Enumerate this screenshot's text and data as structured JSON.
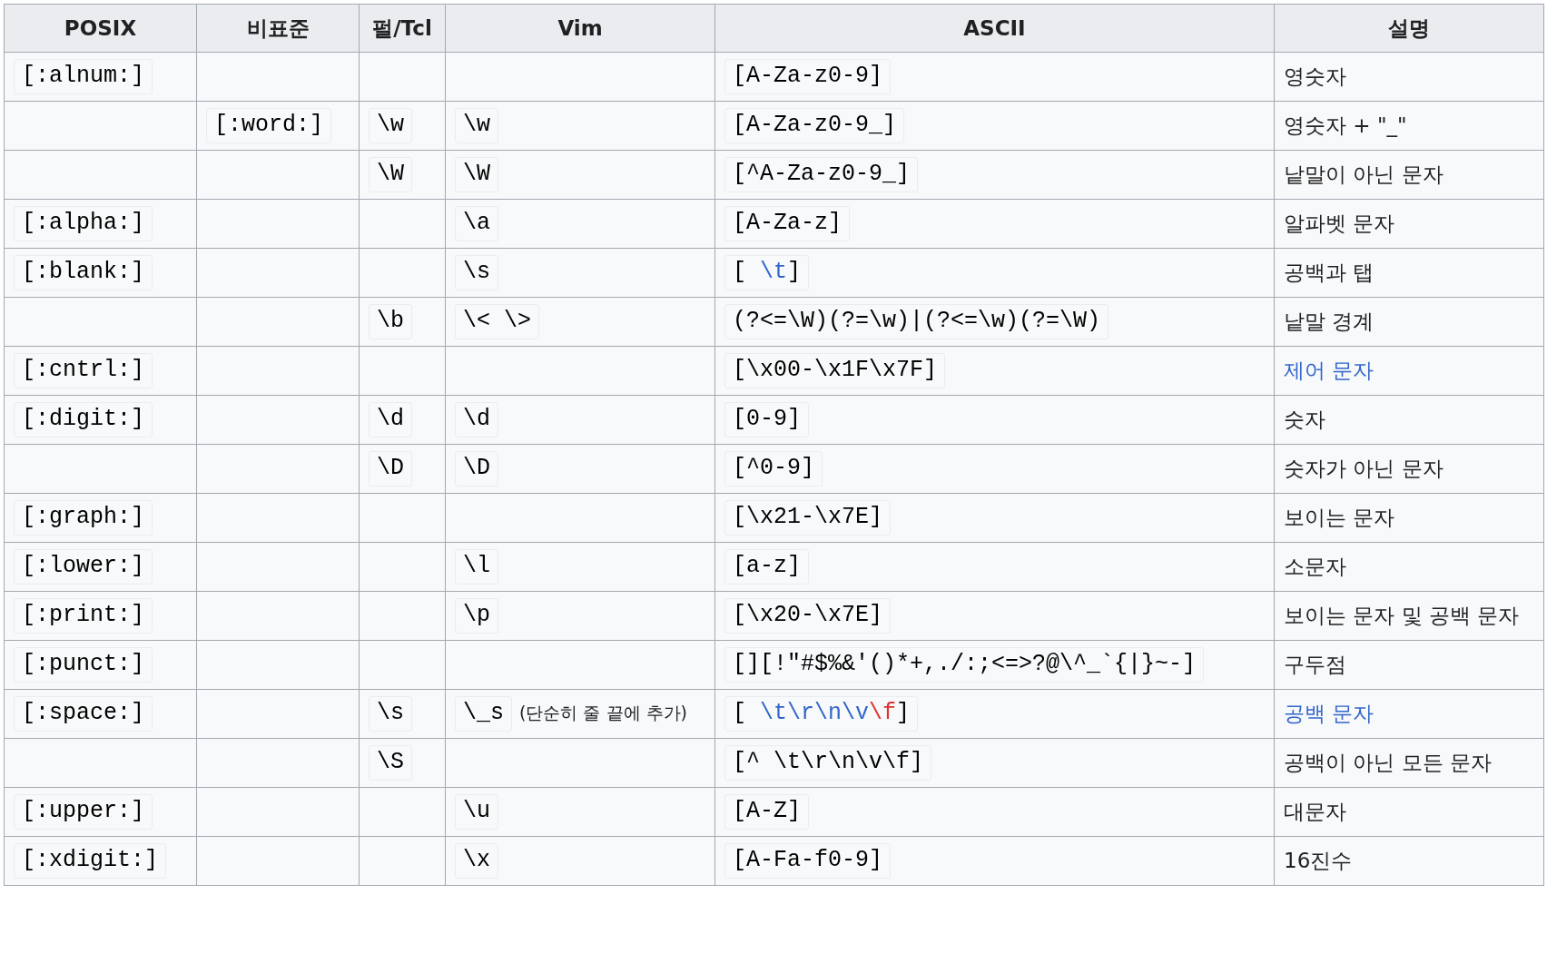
{
  "table": {
    "columns": [
      "POSIX",
      "비표준",
      "펄/Tcl",
      "Vim",
      "ASCII",
      "설명"
    ],
    "rows": [
      {
        "posix": "[:alnum:]",
        "ascii": [
          {
            "text": "[A-Za-z0-9]",
            "kind": "plain"
          }
        ],
        "description": "영숫자",
        "description_link": false
      },
      {
        "nonstandard": "[:word:]",
        "perl_tcl": "\\w",
        "vim": "\\w",
        "ascii": [
          {
            "text": "[A-Za-z0-9_]",
            "kind": "plain"
          }
        ],
        "description": "영숫자 + \"_\"",
        "description_link": false
      },
      {
        "perl_tcl": "\\W",
        "vim": "\\W",
        "ascii": [
          {
            "text": "[^A-Za-z0-9_]",
            "kind": "plain"
          }
        ],
        "description": "낱말이 아닌 문자",
        "description_link": false
      },
      {
        "posix": "[:alpha:]",
        "vim": "\\a",
        "ascii": [
          {
            "text": "[A-Za-z]",
            "kind": "plain"
          }
        ],
        "description": "알파벳 문자",
        "description_link": false
      },
      {
        "posix": "[:blank:]",
        "vim": "\\s",
        "ascii": [
          {
            "text": "[ ",
            "kind": "plain"
          },
          {
            "text": "\\t",
            "kind": "link"
          },
          {
            "text": "]",
            "kind": "plain"
          }
        ],
        "description": "공백과 탭",
        "description_link": false
      },
      {
        "perl_tcl": "\\b",
        "vim": "\\< \\>",
        "ascii": [
          {
            "text": "(?<=\\W)(?=\\w)|(?<=\\w)(?=\\W)",
            "kind": "plain"
          }
        ],
        "description": "낱말 경계",
        "description_link": false
      },
      {
        "posix": "[:cntrl:]",
        "ascii": [
          {
            "text": "[\\x00-\\x1F\\x7F]",
            "kind": "plain"
          }
        ],
        "description": "제어 문자",
        "description_link": true
      },
      {
        "posix": "[:digit:]",
        "perl_tcl": "\\d",
        "vim": "\\d",
        "ascii": [
          {
            "text": "[0-9]",
            "kind": "plain"
          }
        ],
        "description": "숫자",
        "description_link": false
      },
      {
        "perl_tcl": "\\D",
        "vim": "\\D",
        "ascii": [
          {
            "text": "[^0-9]",
            "kind": "plain"
          }
        ],
        "description": "숫자가 아닌 문자",
        "description_link": false
      },
      {
        "posix": "[:graph:]",
        "ascii": [
          {
            "text": "[\\x21-\\x7E]",
            "kind": "plain"
          }
        ],
        "description": "보이는 문자",
        "description_link": false
      },
      {
        "posix": "[:lower:]",
        "vim": "\\l",
        "ascii": [
          {
            "text": "[a-z]",
            "kind": "plain"
          }
        ],
        "description": "소문자",
        "description_link": false
      },
      {
        "posix": "[:print:]",
        "vim": "\\p",
        "ascii": [
          {
            "text": "[\\x20-\\x7E]",
            "kind": "plain"
          }
        ],
        "description": "보이는 문자 및 공백 문자",
        "description_link": false
      },
      {
        "posix": "[:punct:]",
        "ascii": [
          {
            "text": "[][!\"#$%&'()*+,./:;<=>?@\\^_`{|}~-]",
            "kind": "plain"
          }
        ],
        "description": "구두점",
        "description_link": false
      },
      {
        "posix": "[:space:]",
        "perl_tcl": "\\s",
        "vim": "\\_s",
        "vim_note": "(단순히 줄 끝에 추가)",
        "ascii": [
          {
            "text": "[ ",
            "kind": "plain"
          },
          {
            "text": "\\t\\r\\n\\v",
            "kind": "link"
          },
          {
            "text": "\\f",
            "kind": "new-link"
          },
          {
            "text": "]",
            "kind": "plain"
          }
        ],
        "description": "공백 문자",
        "description_link": true
      },
      {
        "perl_tcl": "\\S",
        "ascii": [
          {
            "text": "[^ \\t\\r\\n\\v\\f]",
            "kind": "plain"
          }
        ],
        "description": "공백이 아닌 모든 문자",
        "description_link": false
      },
      {
        "posix": "[:upper:]",
        "vim": "\\u",
        "ascii": [
          {
            "text": "[A-Z]",
            "kind": "plain"
          }
        ],
        "description": "대문자",
        "description_link": false
      },
      {
        "posix": "[:xdigit:]",
        "vim": "\\x",
        "ascii": [
          {
            "text": "[A-Fa-f0-9]",
            "kind": "plain"
          }
        ],
        "description": "16진수",
        "description_link": false
      }
    ]
  }
}
